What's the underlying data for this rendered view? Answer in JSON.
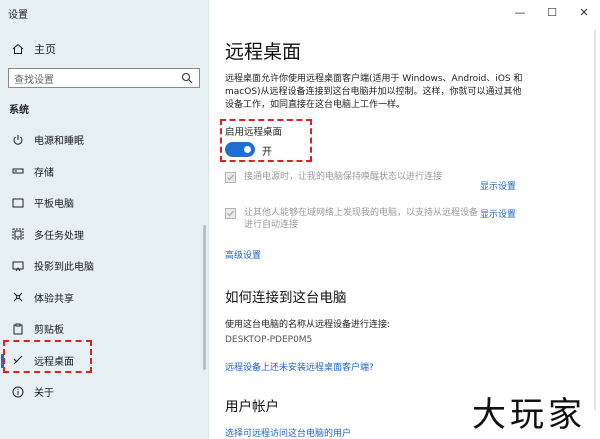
{
  "app": {
    "title": "设置"
  },
  "window_controls": {
    "minimize": "—",
    "maximize": "☐",
    "close": "✕"
  },
  "sidebar": {
    "home": "主页",
    "search_placeholder": "查找设置",
    "section": "系统",
    "items": [
      {
        "label": "电源和睡眠",
        "icon": "power-icon"
      },
      {
        "label": "存储",
        "icon": "storage-icon"
      },
      {
        "label": "平板电脑",
        "icon": "tablet-icon"
      },
      {
        "label": "多任务处理",
        "icon": "multitask-icon"
      },
      {
        "label": "投影到此电脑",
        "icon": "project-icon"
      },
      {
        "label": "体验共享",
        "icon": "share-icon"
      },
      {
        "label": "剪贴板",
        "icon": "clipboard-icon"
      },
      {
        "label": "远程桌面",
        "icon": "remote-desktop-icon",
        "active": true
      },
      {
        "label": "关于",
        "icon": "info-icon"
      }
    ]
  },
  "main": {
    "title": "远程桌面",
    "description": "远程桌面允许你使用远程桌面客户端(适用于 Windows、Android、iOS 和 macOS)从远程设备连接到这台电脑并加以控制。这样，你就可以通过其他设备工作，如同直接在这台电脑上工作一样。",
    "toggle_label": "启用远程桌面",
    "toggle_state": "开",
    "toggle_on": true,
    "option1": "接通电源时，让我的电脑保持唤醒状态以进行连接",
    "option1_link": "显示设置",
    "option2": "让其他人能够在域网络上发现我的电脑，以支持从远程设备进行自动连接",
    "option2_link": "显示设置",
    "advanced_link": "高级设置",
    "connect_heading": "如何连接到这台电脑",
    "connect_desc": "使用这台电脑的名称从远程设备进行连接:",
    "pc_name": "DESKTOP-PDEP0M5",
    "no_client_link": "远程设备上还未安装远程桌面客户端?",
    "accounts_heading": "用户帐户",
    "select_users_link": "选择可远程访问这台电脑的用户"
  },
  "watermark": "大玩家",
  "colors": {
    "accent": "#1f6fd1",
    "link": "#1b63c5",
    "highlight": "#e02020",
    "sidebar_bg": "#e6f0f3"
  }
}
